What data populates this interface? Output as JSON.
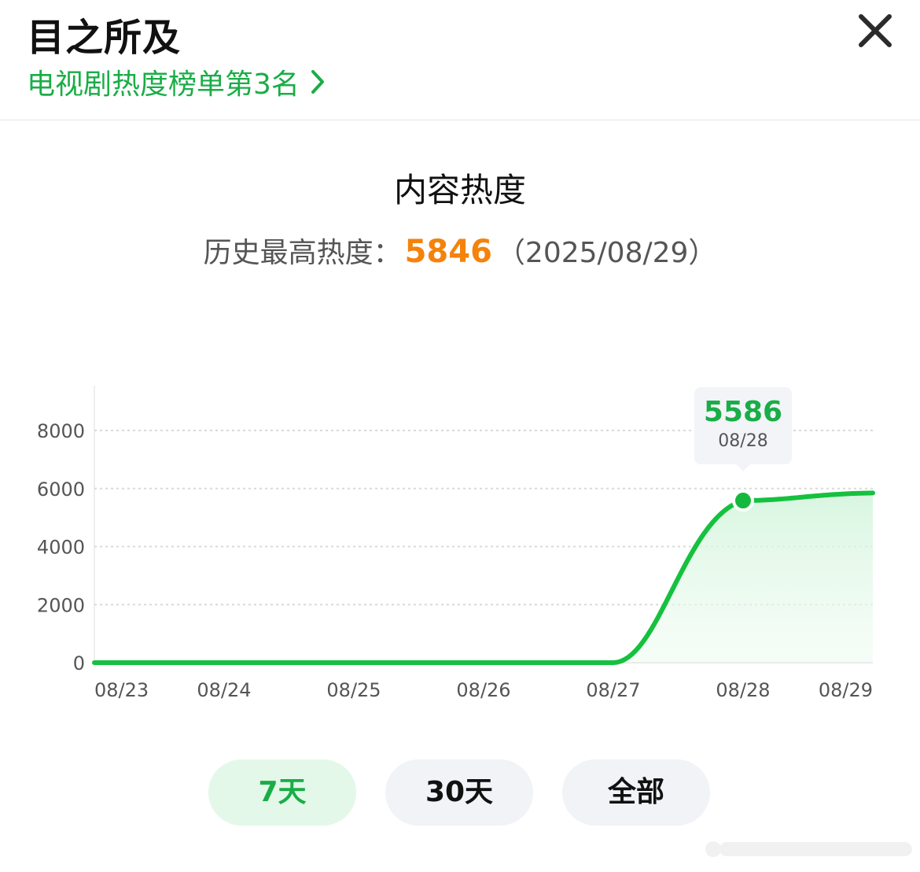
{
  "header": {
    "app_title": "目之所及",
    "rank_link": "电视剧热度榜单第3名",
    "chevron_icon": "chevron-right-icon",
    "close_icon": "close-icon"
  },
  "section": {
    "title": "内容热度",
    "peak_label": "历史最高热度：",
    "peak_value": "5846",
    "peak_date": "（2025/08/29）"
  },
  "tooltip": {
    "value": "5586",
    "date": "08/28"
  },
  "range_buttons": [
    {
      "label": "7天",
      "active": true
    },
    {
      "label": "30天",
      "active": false
    },
    {
      "label": "全部",
      "active": false
    }
  ],
  "colors": {
    "accent": "#1aad47",
    "line": "#15c13f",
    "peak": "#f5820b"
  },
  "chart_data": {
    "type": "area",
    "categories": [
      "08/23",
      "08/24",
      "08/25",
      "08/26",
      "08/27",
      "08/28",
      "08/29"
    ],
    "values": [
      0,
      0,
      0,
      0,
      0,
      5586,
      5846
    ],
    "yticks": [
      0,
      2000,
      4000,
      6000,
      8000
    ],
    "ylim": [
      0,
      8000
    ],
    "grid": true,
    "highlight": {
      "category": "08/28",
      "value": 5586
    }
  }
}
